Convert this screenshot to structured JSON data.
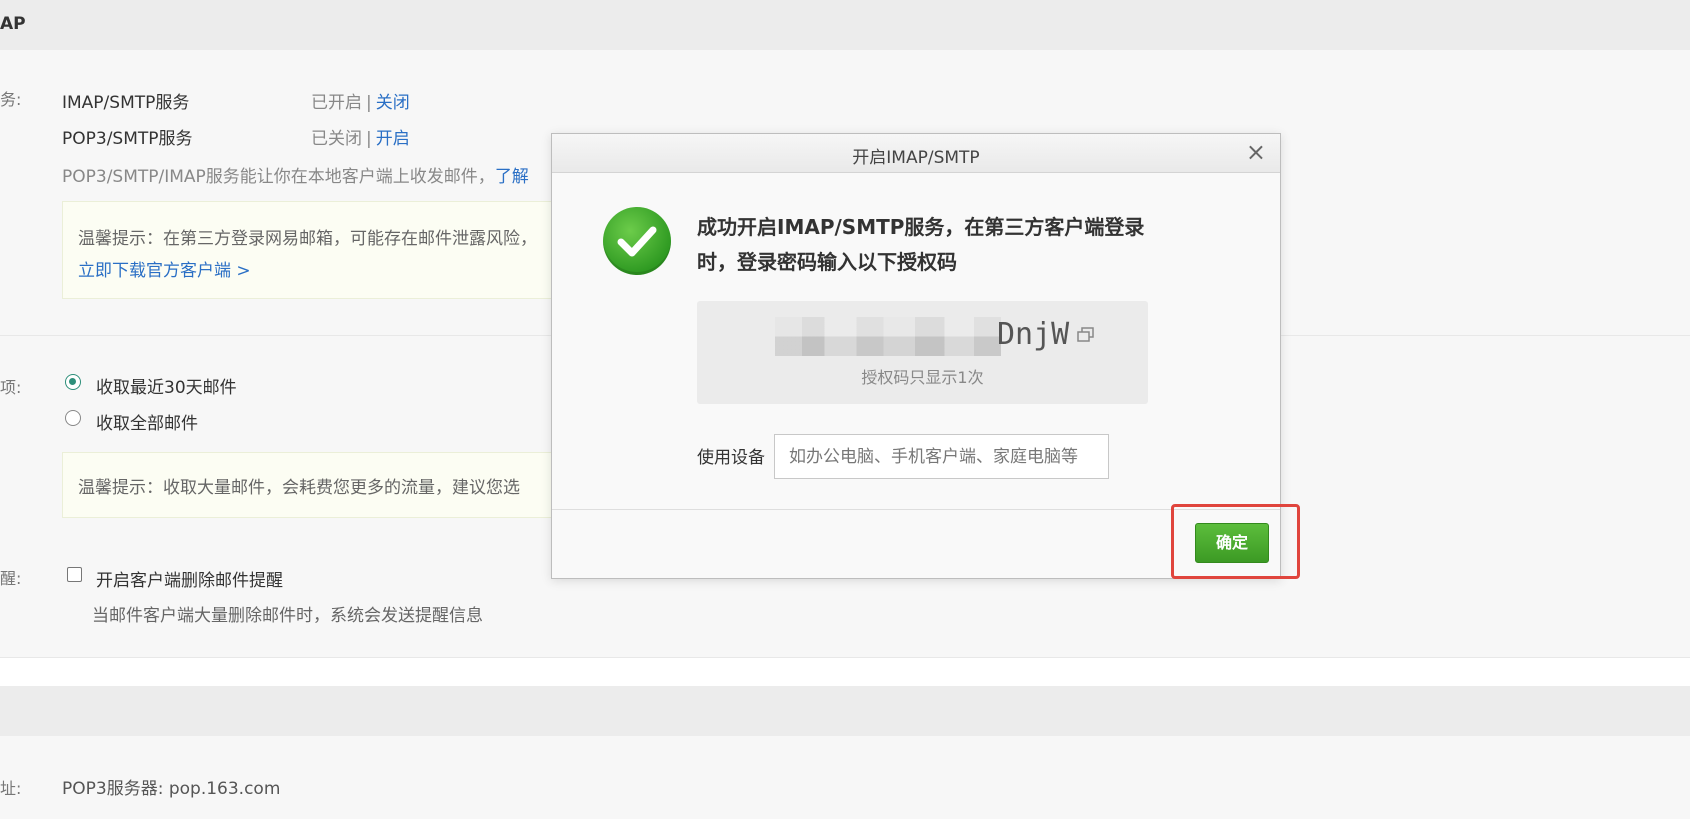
{
  "section": {
    "title": "AP"
  },
  "services": {
    "row_label": "务:",
    "items": [
      {
        "name": "IMAP/SMTP服务",
        "status": "已开启",
        "action": "关闭"
      },
      {
        "name": "POP3/SMTP服务",
        "status": "已关闭",
        "action": "开启"
      }
    ],
    "description": "POP3/SMTP/IMAP服务能让你在本地客户端上收发邮件，",
    "description_link": "了解",
    "tip": "温馨提示：在第三方登录网易邮箱，可能存在邮件泄露风险，",
    "tip_link": "立即下载官方客户端 >"
  },
  "receive_options": {
    "row_label": "项:",
    "options": [
      {
        "label": "收取最近30天邮件",
        "checked": true
      },
      {
        "label": "收取全部邮件",
        "checked": false
      }
    ],
    "tip": "温馨提示：收取大量邮件，会耗费您更多的流量，建议您选"
  },
  "delete_reminder": {
    "row_label": "醒:",
    "checkbox_label": "开启客户端删除邮件提醒",
    "note": "当邮件客户端大量删除邮件时，系统会发送提醒信息"
  },
  "server": {
    "row_label": "址:",
    "pop3": "POP3服务器: pop.163.com"
  },
  "modal": {
    "title": "开启IMAP/SMTP",
    "close_symbol": "×",
    "message": "成功开启IMAP/SMTP服务，在第三方客户端登录时，登录密码输入以下授权码",
    "code_visible": "DnjW",
    "code_note": "授权码只显示1次",
    "device_label": "使用设备",
    "device_placeholder": "如办公电脑、手机客户端、家庭电脑等",
    "ok_label": "确定"
  },
  "colors": {
    "link": "#2a6fc5",
    "ok_button": "#4aa92e",
    "highlight": "#e0453d",
    "radio_checked": "#2e8f7a"
  }
}
